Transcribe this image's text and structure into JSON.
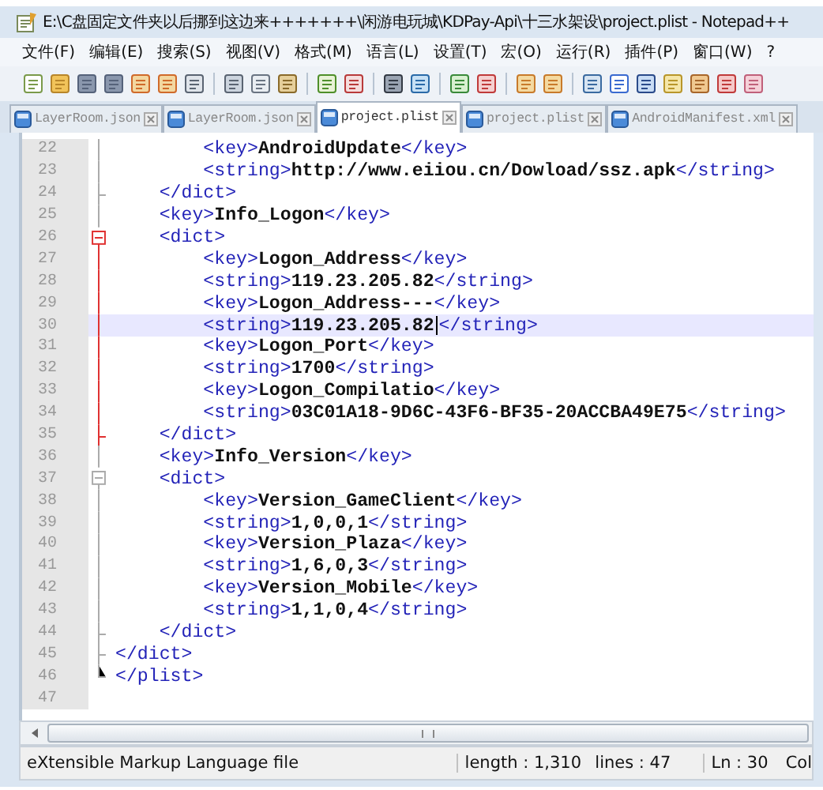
{
  "window": {
    "title": "E:\\C盘固定文件夹以后挪到这边来+++++++\\闲游电玩城\\KDPay-Api\\十三水架设\\project.plist - Notepad++"
  },
  "menu": [
    "文件(F)",
    "编辑(E)",
    "搜索(S)",
    "视图(V)",
    "格式(M)",
    "语言(L)",
    "设置(T)",
    "宏(O)",
    "运行(R)",
    "插件(P)",
    "窗口(W)",
    "?"
  ],
  "tabs": [
    {
      "label": "LayerRoom.json",
      "selected": false
    },
    {
      "label": "LayerRoom.json",
      "selected": false
    },
    {
      "label": "project.plist",
      "selected": true
    },
    {
      "label": "project.plist",
      "selected": false
    },
    {
      "label": "AndroidManifest.xml",
      "selected": false
    }
  ],
  "editor": {
    "lines": [
      {
        "number": "22",
        "code": "        <key>AndroidUpdate</key>",
        "kind": "line",
        "current": false
      },
      {
        "number": "23",
        "code": "        <string>http://www.eiiou.cn/Dowload/ssz.apk</string>",
        "kind": "line",
        "current": false
      },
      {
        "number": "24",
        "code": "    </dict>",
        "kind": "end",
        "current": false
      },
      {
        "number": "25",
        "code": "    <key>Info_Logon</key>",
        "kind": "line",
        "current": false
      },
      {
        "number": "26",
        "code": "    <dict>",
        "kind": "open-active",
        "current": false
      },
      {
        "number": "27",
        "code": "        <key>Logon_Address</key>",
        "kind": "active",
        "current": false
      },
      {
        "number": "28",
        "code": "        <string>119.23.205.82</string>",
        "kind": "active",
        "current": false
      },
      {
        "number": "29",
        "code": "        <key>Logon_Address---</key>",
        "kind": "active",
        "current": false
      },
      {
        "number": "30",
        "code": "        <string>119.23.205.82</string>",
        "kind": "active",
        "current": true
      },
      {
        "number": "31",
        "code": "        <key>Logon_Port</key>",
        "kind": "active",
        "current": false
      },
      {
        "number": "32",
        "code": "        <string>1700</string>",
        "kind": "active",
        "current": false
      },
      {
        "number": "33",
        "code": "        <key>Logon_Compilatio</key>",
        "kind": "active",
        "current": false
      },
      {
        "number": "34",
        "code": "        <string>03C01A18-9D6C-43F6-BF35-20ACCBA49E75</string>",
        "kind": "active",
        "current": false
      },
      {
        "number": "35",
        "code": "    </dict>",
        "kind": "end-active",
        "current": false
      },
      {
        "number": "36",
        "code": "    <key>Info_Version</key>",
        "kind": "line",
        "current": false
      },
      {
        "number": "37",
        "code": "    <dict>",
        "kind": "open",
        "current": false
      },
      {
        "number": "38",
        "code": "        <key>Version_GameClient</key>",
        "kind": "line",
        "current": false
      },
      {
        "number": "39",
        "code": "        <string>1,0,0,1</string>",
        "kind": "line",
        "current": false
      },
      {
        "number": "40",
        "code": "        <key>Version_Plaza</key>",
        "kind": "line",
        "current": false
      },
      {
        "number": "41",
        "code": "        <string>1,6,0,3</string>",
        "kind": "line",
        "current": false
      },
      {
        "number": "42",
        "code": "        <key>Version_Mobile</key>",
        "kind": "line",
        "current": false
      },
      {
        "number": "43",
        "code": "        <string>1,1,0,4</string>",
        "kind": "line",
        "current": false
      },
      {
        "number": "44",
        "code": "    </dict>",
        "kind": "end",
        "current": false
      },
      {
        "number": "45",
        "code": "</dict>",
        "kind": "end",
        "current": false
      },
      {
        "number": "46",
        "code": "</plist>",
        "kind": "last",
        "current": false
      },
      {
        "number": "47",
        "kind": "none",
        "current": false
      }
    ]
  },
  "status_bar": {
    "file_type": "eXtensible Markup Language file",
    "length": "length : 1,310",
    "lines": "lines : 47",
    "position": "Ln : 30",
    "column": "Col"
  }
}
